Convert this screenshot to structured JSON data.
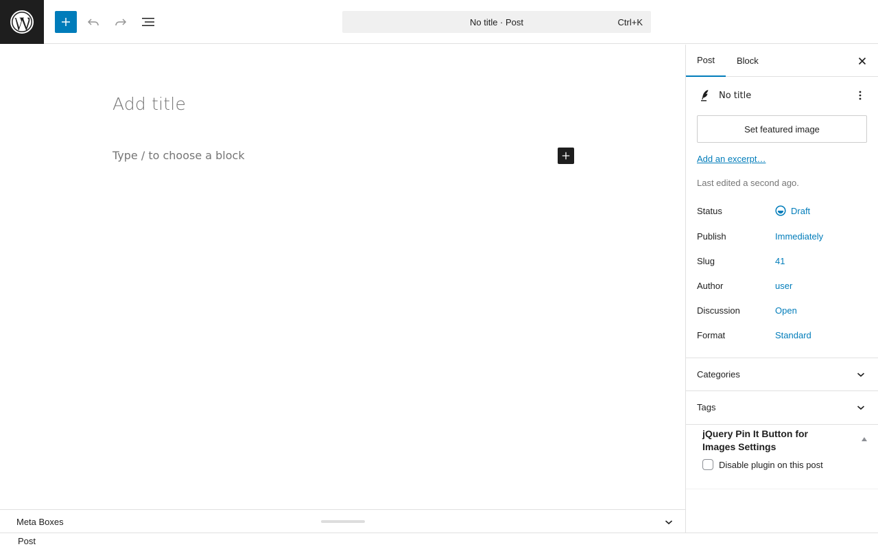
{
  "header": {
    "command_bar_text": "No title · Post",
    "command_shortcut": "Ctrl+K"
  },
  "canvas": {
    "title_placeholder": "Add title",
    "block_placeholder": "Type / to choose a block"
  },
  "meta_boxes": {
    "label": "Meta Boxes"
  },
  "footer": {
    "breadcrumb": "Post"
  },
  "sidebar": {
    "tabs": [
      {
        "label": "Post"
      },
      {
        "label": "Block"
      }
    ],
    "post_name": "No title",
    "featured_image_label": "Set featured image",
    "excerpt_link": "Add an excerpt…",
    "last_edited": "Last edited a second ago.",
    "fields": [
      {
        "key": "Status",
        "value": "Draft"
      },
      {
        "key": "Publish",
        "value": "Immediately"
      },
      {
        "key": "Slug",
        "value": "41"
      },
      {
        "key": "Author",
        "value": "user"
      },
      {
        "key": "Discussion",
        "value": "Open"
      },
      {
        "key": "Format",
        "value": "Standard"
      }
    ],
    "panels": [
      {
        "title": "Categories"
      },
      {
        "title": "Tags"
      }
    ],
    "plugin": {
      "title": "jQuery Pin It Button for Images Settings",
      "option_label": "Disable plugin on this post"
    }
  },
  "colors": {
    "accent": "#007cba",
    "dark": "#1e1e1e"
  },
  "icons": [
    "wordpress-logo-icon",
    "plus-icon",
    "undo-icon",
    "redo-icon",
    "list-view-icon",
    "close-icon",
    "feather-icon",
    "more-vertical-icon",
    "draft-status-icon",
    "chevron-down-icon",
    "triangle-up-icon"
  ]
}
